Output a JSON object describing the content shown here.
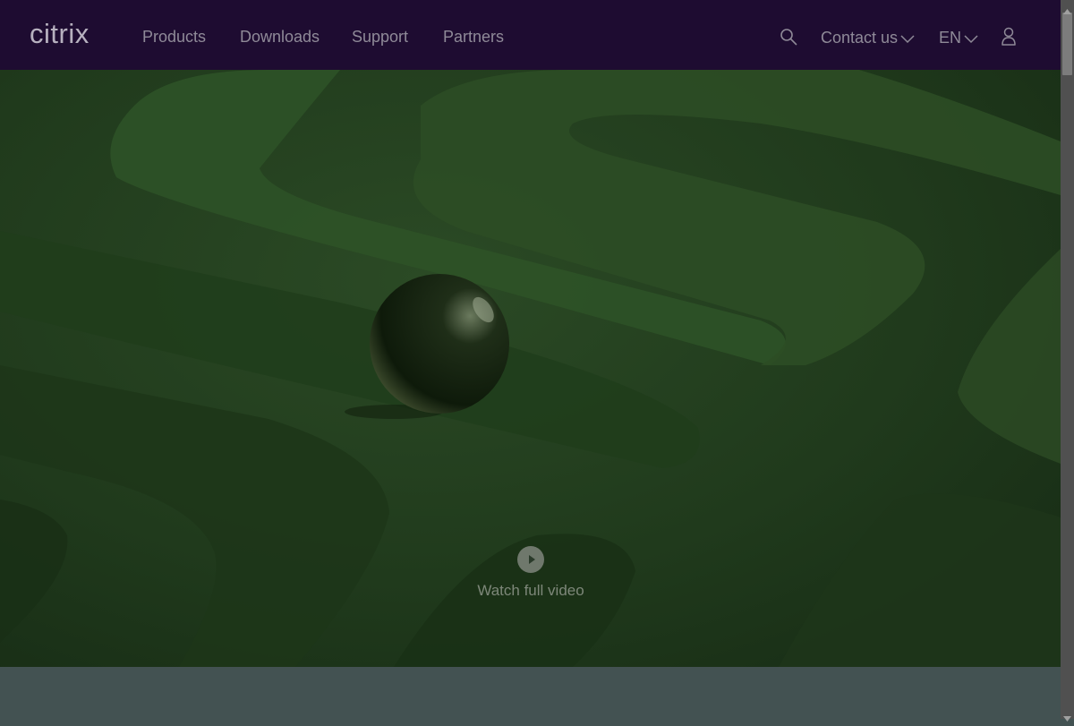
{
  "header": {
    "logo_text": "citrix",
    "nav": [
      "Products",
      "Downloads",
      "Support",
      "Partners"
    ],
    "contact_label": "Contact us",
    "language_label": "EN"
  },
  "hero": {
    "watch_label": "Watch full video"
  },
  "colors": {
    "header_bg": "#1e0c31",
    "hero_green": "#203a1c",
    "band_bg": "#435252"
  }
}
